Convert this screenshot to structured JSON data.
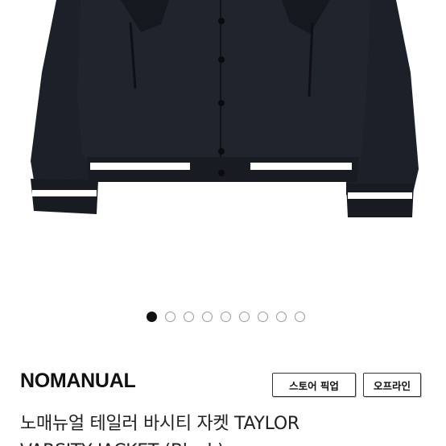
{
  "product": {
    "image": {
      "subject": "black varsity jacket",
      "colors": {
        "body": "#1d2129",
        "stripe": "#ffffff",
        "background": "#ffffff"
      }
    },
    "carousel": {
      "total": 9,
      "active_index": 0
    },
    "brand": "NOMANUAL",
    "badges": {
      "store_pickup": "스토어 픽업",
      "offline": "오프라인"
    },
    "title": {
      "line1": "노매뉴얼 테일러 바시티 자켓 TAYLOR",
      "line2": "VARSITY JACKET (Black)"
    }
  }
}
